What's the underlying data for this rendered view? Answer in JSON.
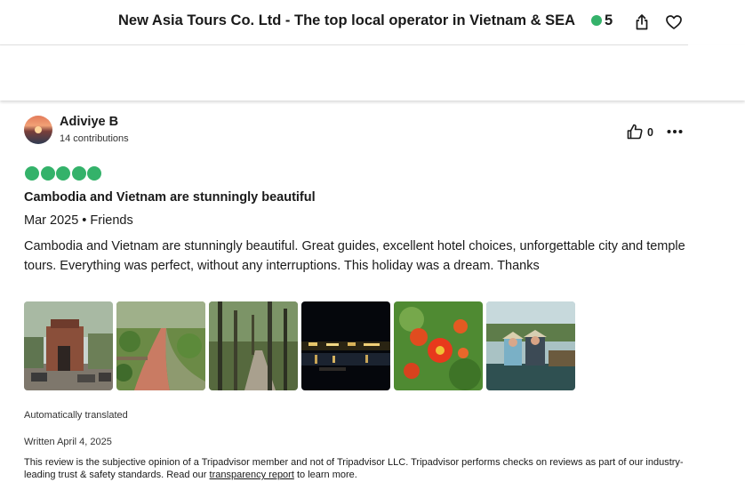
{
  "header": {
    "title": "New Asia Tours Co. Ltd - The top local operator in Vietnam & SEA",
    "rating": "5",
    "rating_color": "#34b26a",
    "share_icon": "share-icon",
    "save_icon": "heart-icon"
  },
  "review": {
    "author": "Adiviye B",
    "contributions": "14 contributions",
    "helpful_count": "0",
    "bubble_rating": 5,
    "bubble_color": "#34b26a",
    "title": "Cambodia and Vietnam are stunningly beautiful",
    "meta": "Mar 2025 • Friends",
    "body": "Cambodia and Vietnam are stunningly beautiful. Great guides, excellent hotel choices, unforgettable city and temple tours. Everything was perfect, without any interruptions. This holiday was a dream. Thanks",
    "photos": [
      {
        "name": "review-photo-gate"
      },
      {
        "name": "review-photo-garden-path"
      },
      {
        "name": "review-photo-forest"
      },
      {
        "name": "review-photo-night-river"
      },
      {
        "name": "review-photo-flowers"
      },
      {
        "name": "review-photo-boat"
      }
    ],
    "auto_translated": "Automatically translated",
    "written": "Written April 4, 2025",
    "disclaimer_before": "This review is the subjective opinion of a Tripadvisor member and not of Tripadvisor LLC. Tripadvisor performs checks on reviews as part of our industry-leading trust & safety standards. Read our ",
    "disclaimer_link": "transparency report",
    "disclaimer_after": " to learn more."
  }
}
